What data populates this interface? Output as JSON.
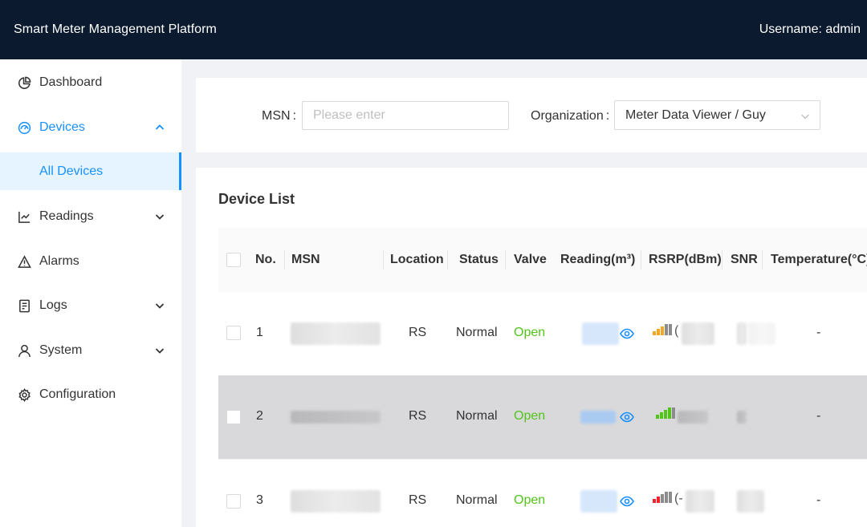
{
  "header": {
    "title": "Smart Meter Management Platform",
    "user": "Username: admin"
  },
  "sidebar": {
    "items": [
      {
        "label": "Dashboard",
        "icon": "pie-chart-icon"
      },
      {
        "label": "Devices",
        "icon": "dashboard-gauge-icon",
        "sub": {
          "label": "All Devices"
        }
      },
      {
        "label": "Readings",
        "icon": "line-chart-icon"
      },
      {
        "label": "Alarms",
        "icon": "warning-icon"
      },
      {
        "label": "Logs",
        "icon": "document-icon"
      },
      {
        "label": "System",
        "icon": "user-icon"
      },
      {
        "label": "Configuration",
        "icon": "gear-icon"
      }
    ]
  },
  "filters": {
    "msn_label": "MSN",
    "msn_colon": ":",
    "msn_placeholder": "Please enter",
    "org_label": "Organization",
    "org_colon": ":",
    "org_value": "Meter Data Viewer / Guy"
  },
  "list": {
    "title": "Device List",
    "columns": [
      "No.",
      "MSN",
      "Location",
      "Status",
      "Valve",
      "Reading(m³)",
      "RSRP(dBm)",
      "SNR",
      "Temperature(°C)"
    ],
    "rows": [
      {
        "no": "1",
        "location": "RS",
        "status": "Normal",
        "valve": "Open",
        "temperature": "-",
        "signal_level": 3,
        "signal_color": "#f5a623"
      },
      {
        "no": "2",
        "location": "RS",
        "status": "Normal",
        "valve": "Open",
        "temperature": "-",
        "signal_level": 4,
        "signal_color": "#52c41a"
      },
      {
        "no": "3",
        "location": "RS",
        "status": "Normal",
        "valve": "Open",
        "temperature": "-",
        "signal_level": 2,
        "signal_color": "#f5222d"
      }
    ]
  },
  "colors": {
    "accent": "#1890ff",
    "header_bg": "#0b1a2e",
    "open": "#52c41a"
  }
}
